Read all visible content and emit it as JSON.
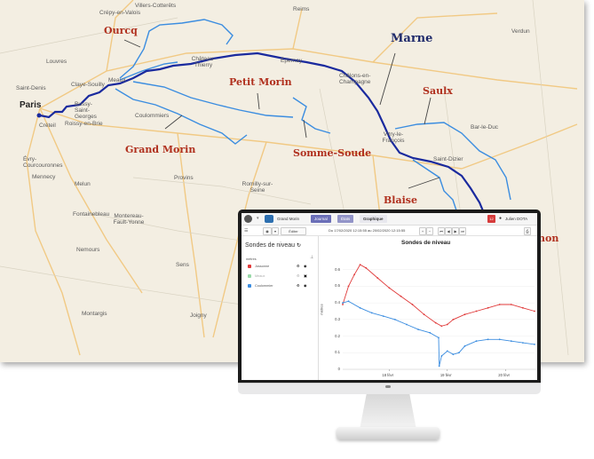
{
  "map": {
    "city_labels": [
      "Villers-Cotterêts",
      "Crépy-en-Valois",
      "Reims",
      "Louvres",
      "Saint-Denis",
      "Claye-Souilly",
      "Meaux",
      "Château-Thierry",
      "Épernay",
      "Châlons-en-Champagne",
      "Verdun",
      "Bussy-Saint-Georges",
      "Roissy-en-Brie",
      "Créteil",
      "Coulommiers",
      "Bar-le-Duc",
      "Vitry-le-François",
      "Saint-Dizier",
      "Évry-Courcouronnes",
      "Mennecy",
      "Provins",
      "Romilly-sur-Seine",
      "Melun",
      "Fontainebleau",
      "Montereau-Fault-Yonne",
      "Nemours",
      "Sens",
      "Montargis",
      "Joigny"
    ],
    "paris_label": "Paris",
    "river_labels": {
      "ourcq": "Ourcq",
      "marne": "Marne",
      "petit_morin": "Petit Morin",
      "saulx": "Saulx",
      "grand_morin": "Grand Morin",
      "somme_soude": "Somme-Soude",
      "blaise": "Blaise",
      "partial": "non"
    },
    "colors": {
      "marne": "#1a2a9e",
      "tributary": "#3b8de0",
      "label_red": "#b0301e",
      "label_navy": "#1f2a6b",
      "land": "#f3eee2"
    }
  },
  "app": {
    "site_select": "Grand Morin",
    "tabs": [
      "Journal",
      "États",
      "Graphique"
    ],
    "alert_count": "12",
    "user": "Julien DOTA",
    "toolbar": {
      "edit_label": "Éditer",
      "date_range": "Du 17/02/2020 12:15:55 au 20/02/2020 12:15:55"
    },
    "sidebar": {
      "title": "Sondes de niveau",
      "header": "mètres",
      "items": [
        {
          "label": "Jossonne",
          "color": "#e03a3a"
        },
        {
          "label": "Meaux",
          "color": "#99d9a8"
        },
        {
          "label": "Coulommier",
          "color": "#3b8de0"
        }
      ]
    }
  },
  "chart_data": {
    "type": "line",
    "title": "Sondes de niveau",
    "ylabel": "mètres",
    "ylim": [
      0,
      0.7
    ],
    "yticks": [
      "0",
      "0.1",
      "0.2",
      "0.3",
      "0.4",
      "0.5",
      "0.6"
    ],
    "xticks": [
      "18 févr",
      "19 févr",
      "20 févr"
    ],
    "xlim": [
      17.2,
      20.5
    ],
    "series": [
      {
        "name": "Jossonne",
        "color": "#e03a3a",
        "x": [
          17.2,
          17.3,
          17.4,
          17.5,
          17.6,
          17.8,
          18.0,
          18.2,
          18.4,
          18.6,
          18.8,
          18.9,
          19.0,
          19.1,
          19.3,
          19.5,
          19.7,
          19.9,
          20.1,
          20.3,
          20.5
        ],
        "y": [
          0.39,
          0.5,
          0.57,
          0.63,
          0.61,
          0.55,
          0.49,
          0.44,
          0.39,
          0.33,
          0.28,
          0.26,
          0.27,
          0.3,
          0.33,
          0.35,
          0.37,
          0.39,
          0.39,
          0.37,
          0.35
        ]
      },
      {
        "name": "Coulommier",
        "color": "#3b8de0",
        "x": [
          17.2,
          17.3,
          17.5,
          17.7,
          17.9,
          18.1,
          18.3,
          18.5,
          18.7,
          18.85,
          18.86,
          18.9,
          19.0,
          19.1,
          19.2,
          19.3,
          19.5,
          19.7,
          19.9,
          20.1,
          20.3,
          20.5
        ],
        "y": [
          0.4,
          0.41,
          0.37,
          0.34,
          0.32,
          0.3,
          0.27,
          0.24,
          0.22,
          0.19,
          0.02,
          0.08,
          0.11,
          0.09,
          0.1,
          0.14,
          0.17,
          0.18,
          0.18,
          0.17,
          0.16,
          0.15
        ]
      }
    ]
  }
}
